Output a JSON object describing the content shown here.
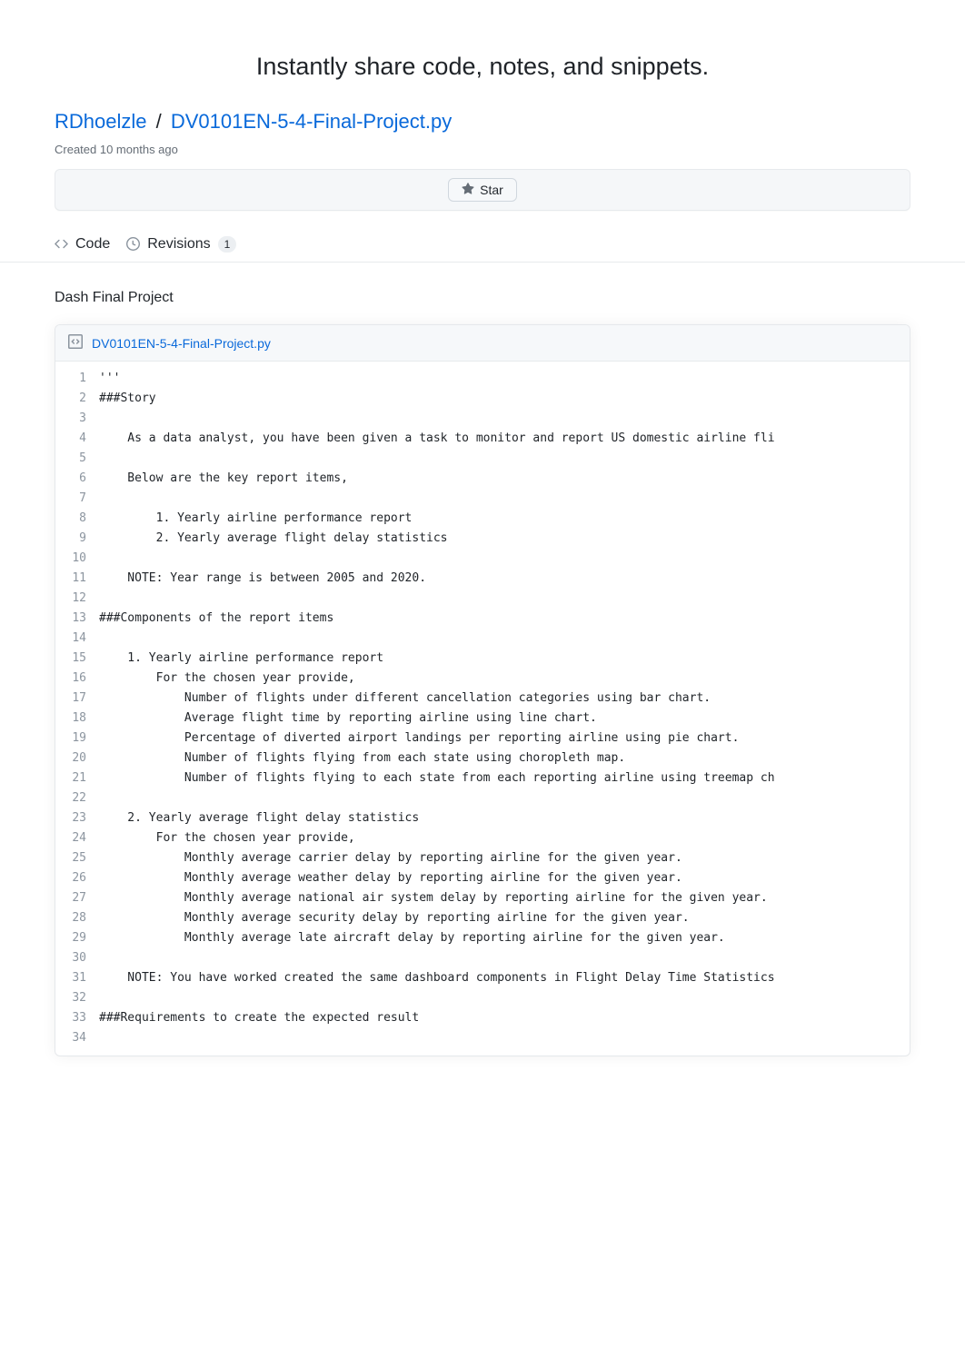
{
  "tagline": "Instantly share code, notes, and snippets.",
  "gist": {
    "user": "RDhoelzle",
    "separator": "/",
    "file": "DV0101EN-5-4-Final-Project.py",
    "created": "Created 10 months ago",
    "star_label": "Star"
  },
  "tabs": {
    "code": "Code",
    "revisions": "Revisions",
    "revisions_count": "1"
  },
  "description": "Dash Final Project",
  "file_header": {
    "name": "DV0101EN-5-4-Final-Project.py"
  },
  "code_lines": [
    "'''",
    "###Story",
    "",
    "    As a data analyst, you have been given a task to monitor and report US domestic airline fli",
    "",
    "    Below are the key report items,",
    "",
    "        1. Yearly airline performance report",
    "        2. Yearly average flight delay statistics",
    "",
    "    NOTE: Year range is between 2005 and 2020.",
    "",
    "###Components of the report items",
    "",
    "    1. Yearly airline performance report",
    "        For the chosen year provide,",
    "            Number of flights under different cancellation categories using bar chart.",
    "            Average flight time by reporting airline using line chart.",
    "            Percentage of diverted airport landings per reporting airline using pie chart.",
    "            Number of flights flying from each state using choropleth map.",
    "            Number of flights flying to each state from each reporting airline using treemap ch",
    "",
    "    2. Yearly average flight delay statistics",
    "        For the chosen year provide,",
    "            Monthly average carrier delay by reporting airline for the given year.",
    "            Monthly average weather delay by reporting airline for the given year.",
    "            Monthly average national air system delay by reporting airline for the given year.",
    "            Monthly average security delay by reporting airline for the given year.",
    "            Monthly average late aircraft delay by reporting airline for the given year.",
    "",
    "    NOTE: You have worked created the same dashboard components in Flight Delay Time Statistics",
    "",
    "###Requirements to create the expected result",
    ""
  ]
}
